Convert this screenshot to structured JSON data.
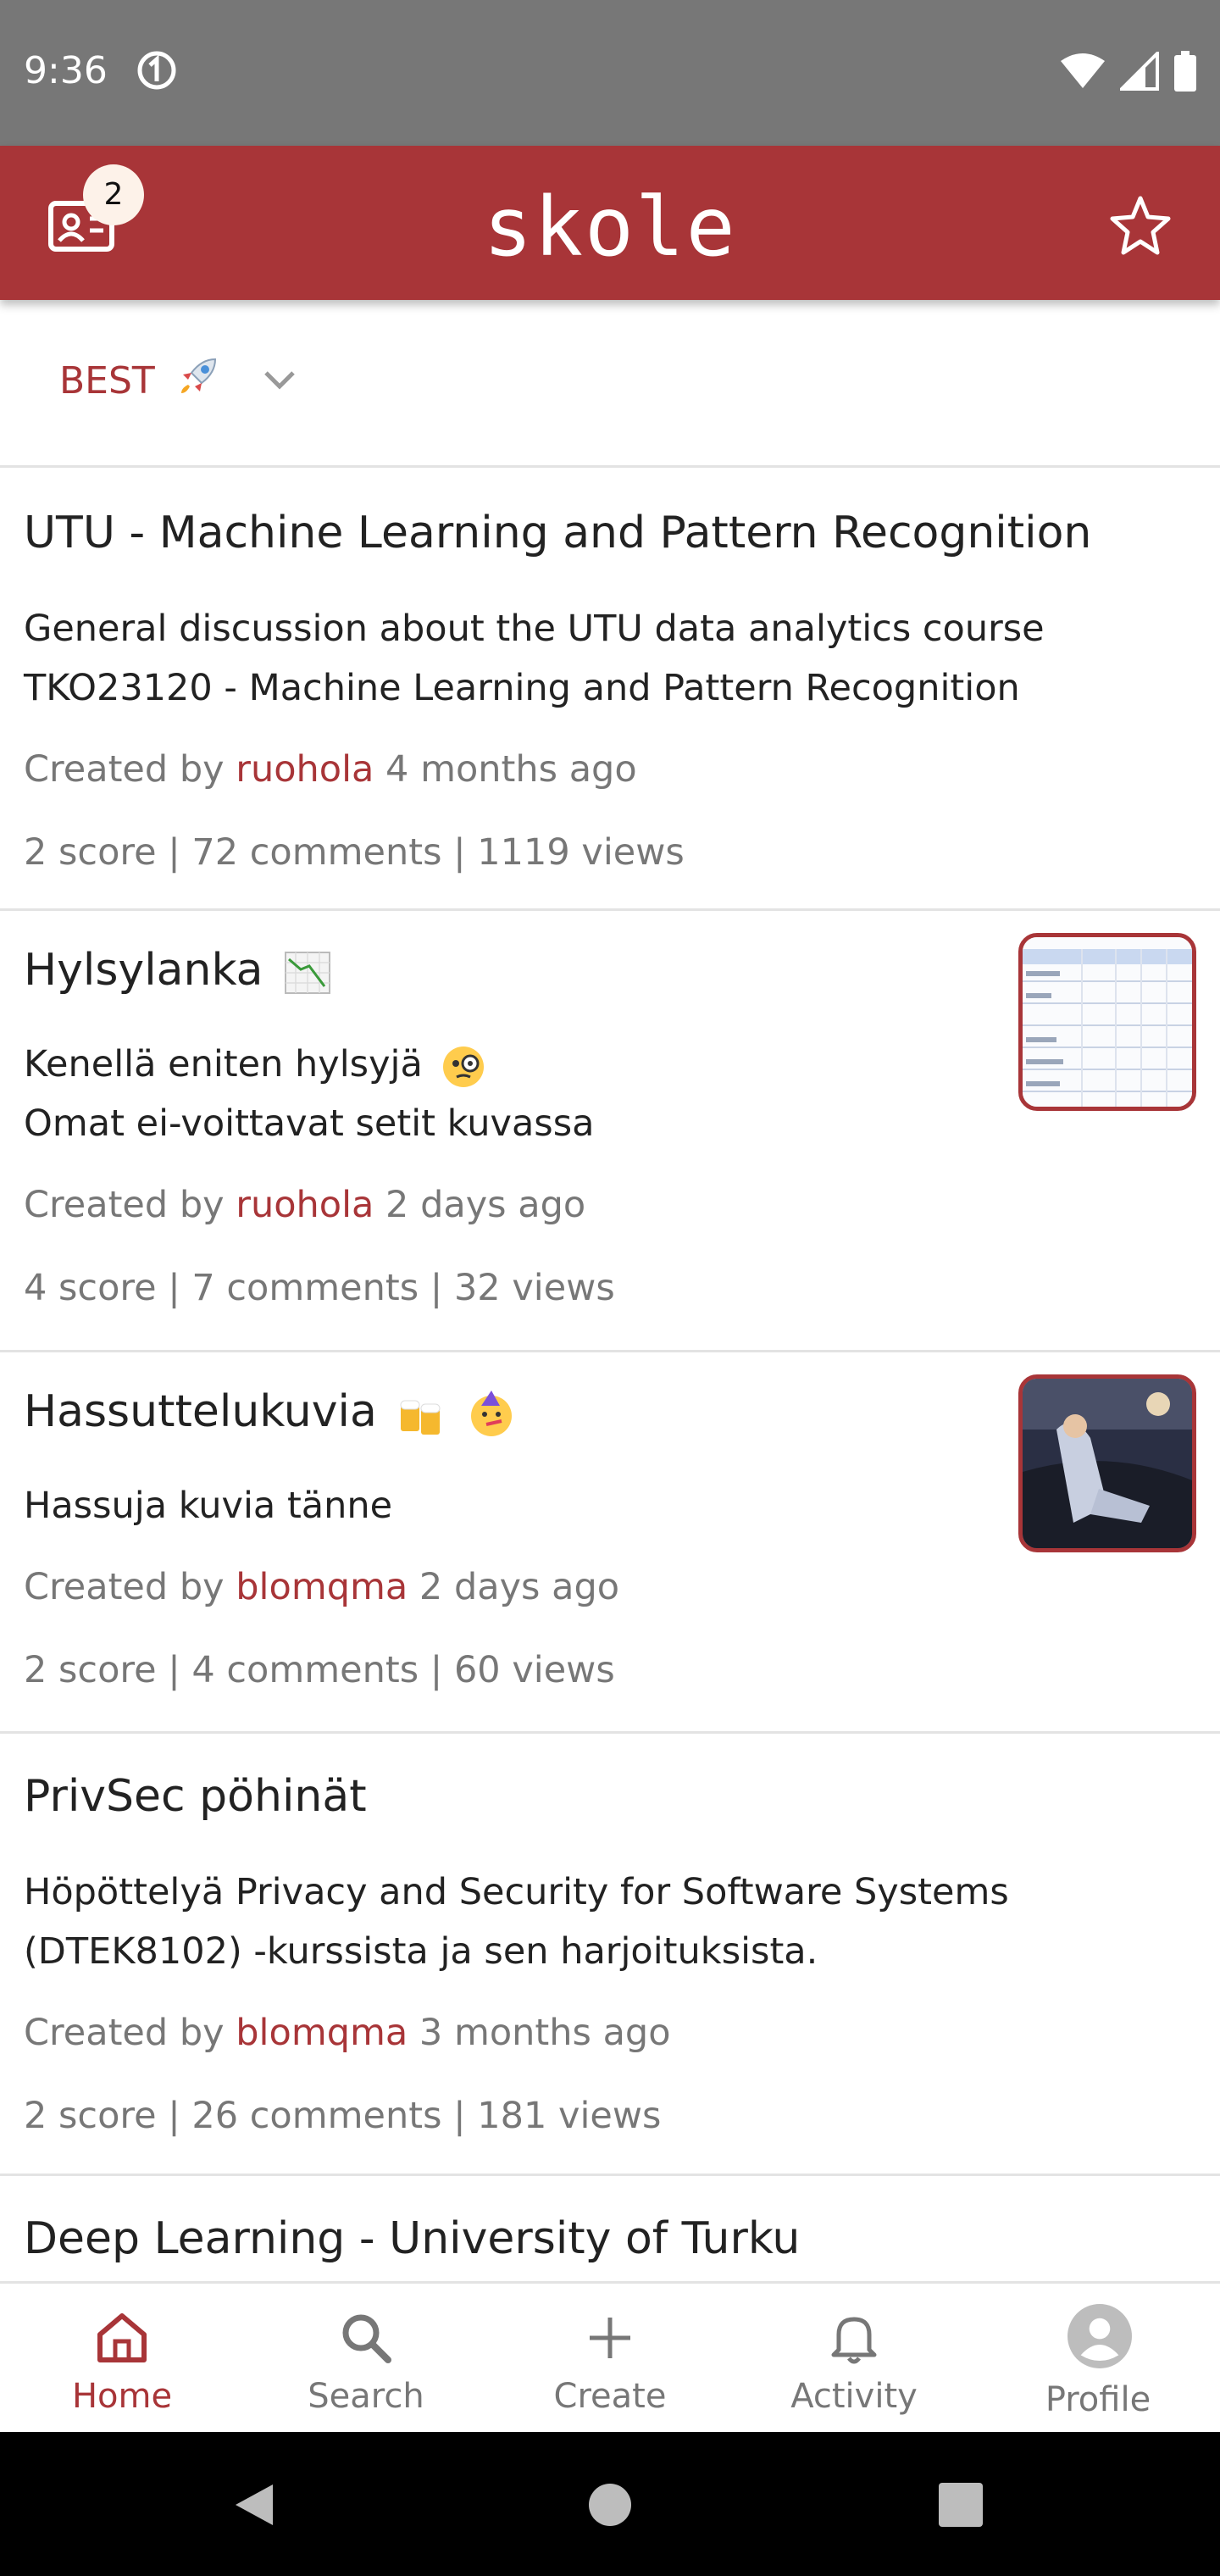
{
  "status_bar": {
    "time": "9:36"
  },
  "app_bar": {
    "title": "skole",
    "badge_count": "2"
  },
  "sort": {
    "label": "BEST"
  },
  "posts": [
    {
      "title": "UTU - Machine Learning and Pattern Recognition",
      "description_lines": [
        "General discussion about the UTU data analytics course",
        "TKO23120 - Machine Learning and Pattern Recognition"
      ],
      "created_prefix": "Created by",
      "author": "ruohola",
      "age": "4 months ago",
      "stats": "2 score | 72 comments | 1119 views"
    },
    {
      "title": "Hylsylanka",
      "description_lines": [
        "Kenellä eniten hylsyjä",
        "Omat ei-voittavat setit kuvassa"
      ],
      "created_prefix": "Created by",
      "author": "ruohola",
      "age": "2 days ago",
      "stats": "4 score | 7 comments | 32 views"
    },
    {
      "title": "Hassuttelukuvia",
      "description_lines": [
        "Hassuja kuvia tänne"
      ],
      "created_prefix": "Created by",
      "author": "blomqma",
      "age": "2 days ago",
      "stats": "2 score | 4 comments | 60 views"
    },
    {
      "title": "PrivSec pöhinät",
      "description_lines": [
        "Höpöttelyä Privacy and Security for Software Systems",
        "(DTEK8102) -kurssista ja sen harjoituksista."
      ],
      "created_prefix": "Created by",
      "author": "blomqma",
      "age": "3 months ago",
      "stats": "2 score | 26 comments | 181 views"
    },
    {
      "title": "Deep Learning - University of Turku"
    }
  ],
  "bottom_nav": [
    {
      "label": "Home",
      "icon": "home-icon",
      "active": true
    },
    {
      "label": "Search",
      "icon": "search-icon"
    },
    {
      "label": "Create",
      "icon": "plus-icon"
    },
    {
      "label": "Activity",
      "icon": "bell-icon"
    },
    {
      "label": "Profile",
      "icon": "avatar-icon"
    }
  ],
  "colors": {
    "primary": "#a83538",
    "status_bar": "#777777",
    "muted_text": "#777777"
  }
}
